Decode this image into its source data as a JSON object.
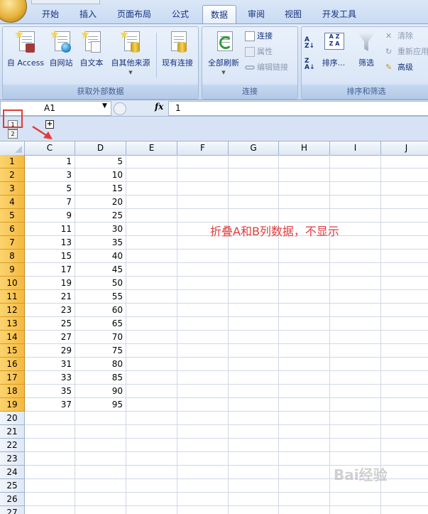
{
  "ribbon": {
    "tabs": [
      {
        "label": "开始"
      },
      {
        "label": "插入"
      },
      {
        "label": "页面布局"
      },
      {
        "label": "公式"
      },
      {
        "label": "数据",
        "active": true
      },
      {
        "label": "审阅"
      },
      {
        "label": "视图"
      },
      {
        "label": "开发工具"
      }
    ],
    "groups": {
      "external": {
        "label": "获取外部数据",
        "buttons": [
          "自 Access",
          "自网站",
          "自文本",
          "自其他来源",
          "现有连接"
        ]
      },
      "connections": {
        "label": "连接",
        "refresh_all": "全部刷新",
        "connections": "连接",
        "properties": "属性",
        "edit_links": "编辑链接"
      },
      "sort_filter": {
        "label": "排序和筛选",
        "sort": "排序...",
        "filter": "筛选",
        "clear": "清除",
        "reapply": "重新应用",
        "advanced": "高级"
      }
    }
  },
  "formula_bar": {
    "name_box": "A1",
    "fx": "fx",
    "value": "1"
  },
  "outline": {
    "levels": [
      "1",
      "2"
    ],
    "expand": "+"
  },
  "grid": {
    "columns": [
      "C",
      "D",
      "E",
      "F",
      "G",
      "H",
      "I",
      "J"
    ],
    "rows": [
      {
        "n": "1",
        "c": "1",
        "d": "5"
      },
      {
        "n": "2",
        "c": "3",
        "d": "10"
      },
      {
        "n": "3",
        "c": "5",
        "d": "15"
      },
      {
        "n": "4",
        "c": "7",
        "d": "20"
      },
      {
        "n": "5",
        "c": "9",
        "d": "25"
      },
      {
        "n": "6",
        "c": "11",
        "d": "30"
      },
      {
        "n": "7",
        "c": "13",
        "d": "35"
      },
      {
        "n": "8",
        "c": "15",
        "d": "40"
      },
      {
        "n": "9",
        "c": "17",
        "d": "45"
      },
      {
        "n": "10",
        "c": "19",
        "d": "50"
      },
      {
        "n": "11",
        "c": "21",
        "d": "55"
      },
      {
        "n": "12",
        "c": "23",
        "d": "60"
      },
      {
        "n": "13",
        "c": "25",
        "d": "65"
      },
      {
        "n": "14",
        "c": "27",
        "d": "70"
      },
      {
        "n": "15",
        "c": "29",
        "d": "75"
      },
      {
        "n": "16",
        "c": "31",
        "d": "80"
      },
      {
        "n": "17",
        "c": "33",
        "d": "85"
      },
      {
        "n": "18",
        "c": "35",
        "d": "90"
      },
      {
        "n": "19",
        "c": "37",
        "d": "95"
      },
      {
        "n": "20",
        "c": "",
        "d": ""
      },
      {
        "n": "21",
        "c": "",
        "d": ""
      },
      {
        "n": "22",
        "c": "",
        "d": ""
      },
      {
        "n": "23",
        "c": "",
        "d": ""
      },
      {
        "n": "24",
        "c": "",
        "d": ""
      },
      {
        "n": "25",
        "c": "",
        "d": ""
      },
      {
        "n": "26",
        "c": "",
        "d": ""
      },
      {
        "n": "27",
        "c": "",
        "d": ""
      }
    ]
  },
  "annotation": {
    "text": "折叠A和B列数据，不显示",
    "color": "#e13b3b"
  },
  "watermark": "Bai经验",
  "colors": {
    "highlight": "#e23a3a",
    "row_header": "#f5b93f"
  }
}
